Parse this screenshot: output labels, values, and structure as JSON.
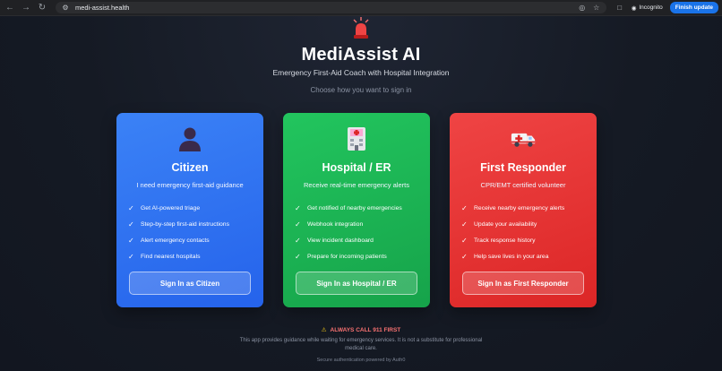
{
  "browser": {
    "url": "medi-assist.health",
    "incognito_label": "Incognito",
    "update_label": "Finish update"
  },
  "header": {
    "title": "MediAssist AI",
    "subtitle": "Emergency First-Aid Coach with Hospital Integration",
    "prompt": "Choose how you want to sign in"
  },
  "cards": [
    {
      "title": "Citizen",
      "description": "I need emergency first-aid guidance",
      "features": [
        "Get AI-powered triage",
        "Step-by-step first-aid instructions",
        "Alert emergency contacts",
        "Find nearest hospitals"
      ],
      "button": "Sign In as Citizen",
      "icon": "person-icon",
      "color": "#2f6ff0"
    },
    {
      "title": "Hospital / ER",
      "description": "Receive real-time emergency alerts",
      "features": [
        "Get notified of nearby emergencies",
        "Webhook integration",
        "View incident dashboard",
        "Prepare for incoming patients"
      ],
      "button": "Sign In as Hospital / ER",
      "icon": "hospital-icon",
      "color": "#1fb655"
    },
    {
      "title": "First Responder",
      "description": "CPR/EMT certified volunteer",
      "features": [
        "Receive nearby emergency alerts",
        "Update your availability",
        "Track response history",
        "Help save lives in your area"
      ],
      "button": "Sign In as First Responder",
      "icon": "ambulance-icon",
      "color": "#e23434"
    }
  ],
  "footer": {
    "warning": "ALWAYS CALL 911 FIRST",
    "disclaimer": "This app provides guidance while waiting for emergency services. It is not a substitute for professional medical care.",
    "auth_note": "Secure authentication powered by Auth0"
  }
}
